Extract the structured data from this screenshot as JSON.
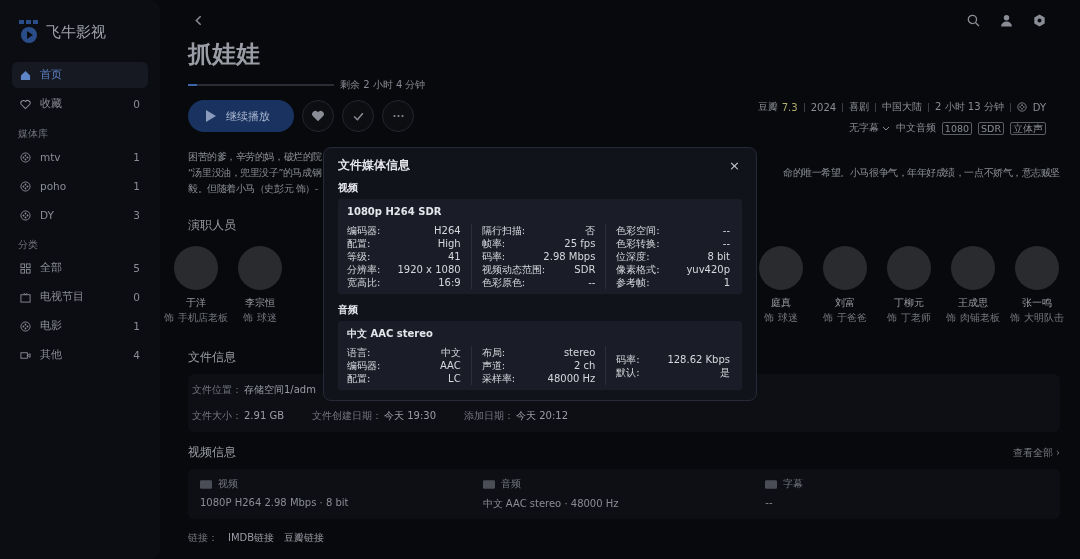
{
  "sidebar": {
    "logo": "飞牛影视",
    "top": [
      {
        "label": "首页",
        "selected": true
      },
      {
        "label": "收藏",
        "count": "0",
        "selected": false
      }
    ],
    "groups": [
      {
        "heading": "媒体库",
        "items": [
          {
            "label": "mtv",
            "count": "1",
            "selected": false
          },
          {
            "label": "poho",
            "count": "1",
            "selected": false
          },
          {
            "label": "DY",
            "count": "3",
            "selected": false
          }
        ]
      },
      {
        "heading": "分类",
        "items": [
          {
            "label": "全部",
            "count": "5",
            "selected": false
          },
          {
            "label": "电视节目",
            "count": "0",
            "selected": false
          },
          {
            "label": "电影",
            "count": "1",
            "selected": false
          },
          {
            "label": "其他",
            "count": "4",
            "selected": false
          }
        ]
      }
    ]
  },
  "title": "抓娃娃",
  "progress": {
    "level": 0.06,
    "remaining": "剩余 2 小时 4 分钟"
  },
  "play_button": "继续播放",
  "meta": {
    "rating_label": "豆瓣",
    "rating": "7.3",
    "items": [
      "2024",
      "喜剧",
      "中国大陆",
      "2 小时 13 分钟"
    ],
    "library": "DY"
  },
  "tracks": {
    "subtitle": "无字幕",
    "audio": "中文音频",
    "tags": [
      "1080",
      "SDR",
      "立体声"
    ]
  },
  "description": [
    {
      "left": "困苦的爹，辛劳的妈，破烂的院"
    },
    {
      "left": "“汤里没油，兜里没子”的马成钢",
      "right": "命的唯一希望。小马很争气，年年好成绩，一点不娇气，意志贼坚"
    },
    {
      "left": "毅。但随着小马（史彭元 饰）-"
    }
  ],
  "cast": {
    "heading": "演职人员",
    "left": [
      {
        "name": "于洋",
        "role": "饰 手机店老板"
      },
      {
        "name": "李宗恒",
        "role": "饰 球迷"
      }
    ],
    "right": [
      {
        "name": "庭真",
        "role": "饰 球迷"
      },
      {
        "name": "刘富",
        "role": "饰 于爸爸"
      },
      {
        "name": "丁柳元",
        "role": "饰 丁老师"
      },
      {
        "name": "王成思",
        "role": "饰 肉铺老板"
      },
      {
        "name": "张一鸣",
        "role": "饰 大明队击"
      }
    ]
  },
  "file_info": {
    "heading": "文件信息",
    "location_label": "文件位置：",
    "location": "存储空间1/adm",
    "size_label": "文件大小：",
    "size": "2.91 GB",
    "created_label": "文件创建日期：",
    "created": "今天 19:30",
    "added_label": "添加日期：",
    "added": "今天 20:12"
  },
  "video_info": {
    "heading": "视频信息",
    "view_all": "查看全部 ›",
    "cards": [
      {
        "label": "视频",
        "value": "1080P H264 2.98 Mbps · 8 bit"
      },
      {
        "label": "音频",
        "value": "中文 AAC stereo · 48000 Hz"
      },
      {
        "label": "字幕",
        "value": "--"
      }
    ]
  },
  "links": {
    "label": "链接：",
    "items": [
      "IMDB链接",
      "豆瓣链接"
    ]
  },
  "modal": {
    "title": "文件媒体信息",
    "close": "×",
    "sections": [
      {
        "heading": "视频",
        "stream": "1080p H264 SDR",
        "columns": [
          [
            {
              "key": "编码器:",
              "value": "H264"
            },
            {
              "key": "配置:",
              "value": "High"
            },
            {
              "key": "等级:",
              "value": "41"
            },
            {
              "key": "分辨率:",
              "value": "1920 x 1080"
            },
            {
              "key": "宽高比:",
              "value": "16:9"
            }
          ],
          [
            {
              "key": "隔行扫描:",
              "value": "否"
            },
            {
              "key": "帧率:",
              "value": "25 fps"
            },
            {
              "key": "码率:",
              "value": "2.98 Mbps"
            },
            {
              "key": "视频动态范围:",
              "value": "SDR"
            },
            {
              "key": "色彩原色:",
              "value": "--"
            }
          ],
          [
            {
              "key": "色彩空间:",
              "value": "--"
            },
            {
              "key": "色彩转换:",
              "value": "--"
            },
            {
              "key": "位深度:",
              "value": "8 bit"
            },
            {
              "key": "像素格式:",
              "value": "yuv420p"
            },
            {
              "key": "参考帧:",
              "value": "1"
            }
          ]
        ]
      },
      {
        "heading": "音频",
        "stream": "中文 AAC stereo",
        "columns": [
          [
            {
              "key": "语言:",
              "value": "中文"
            },
            {
              "key": "编码器:",
              "value": "AAC"
            },
            {
              "key": "配置:",
              "value": "LC"
            }
          ],
          [
            {
              "key": "布局:",
              "value": "stereo"
            },
            {
              "key": "声道:",
              "value": "2 ch"
            },
            {
              "key": "采样率:",
              "value": "48000 Hz"
            }
          ],
          [
            {
              "key": "码率:",
              "value": "128.62 Kbps"
            },
            {
              "key": "默认:",
              "value": "是"
            }
          ]
        ]
      }
    ]
  }
}
